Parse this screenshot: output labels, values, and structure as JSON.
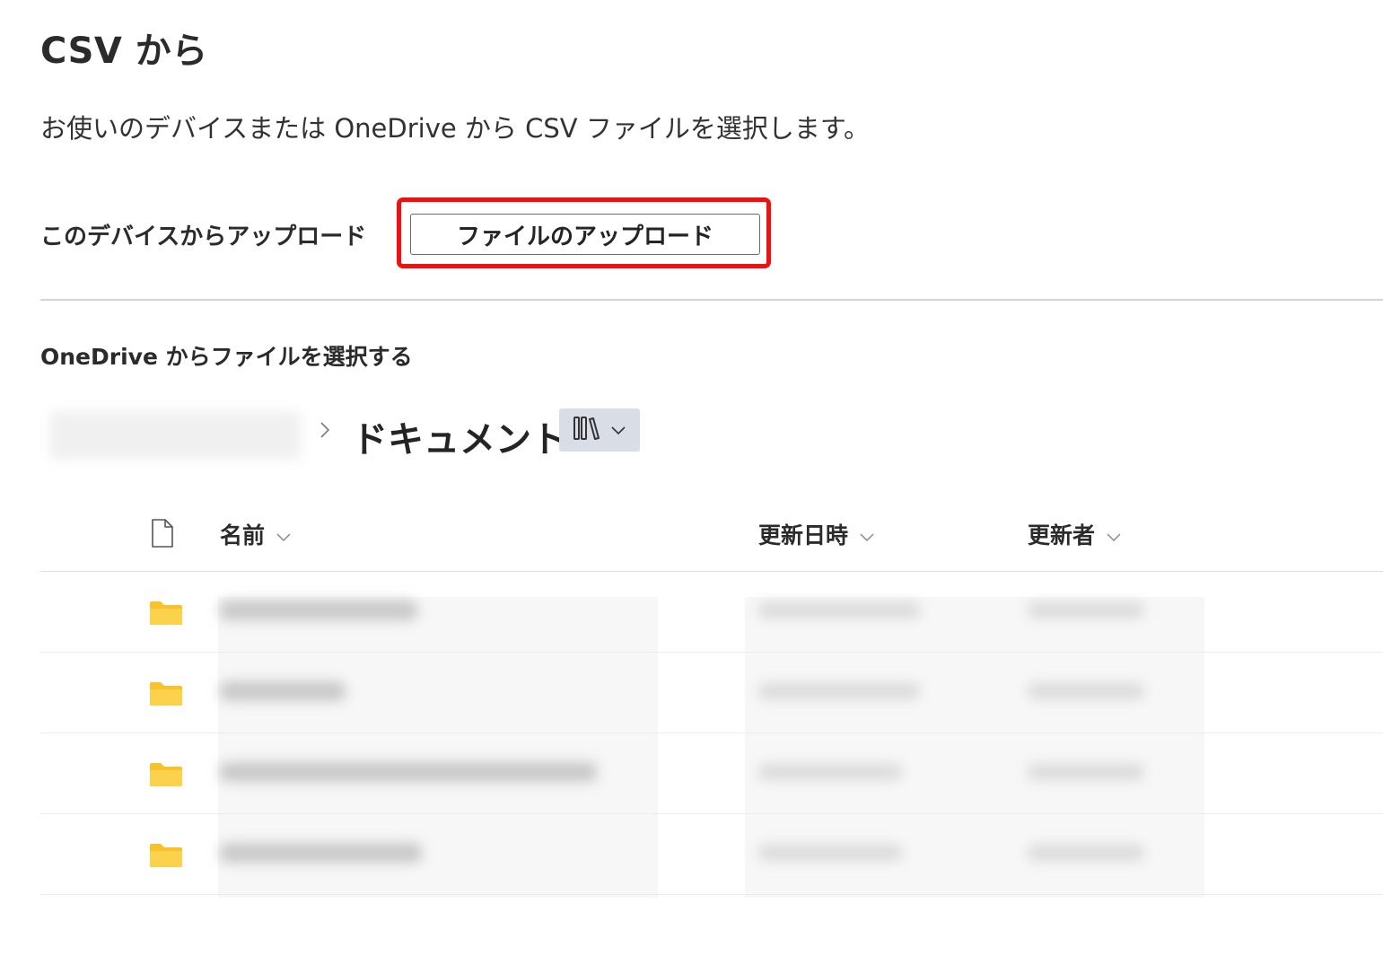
{
  "header": {
    "title": "CSV から",
    "subtitle": "お使いのデバイスまたは OneDrive から CSV ファイルを選択します。"
  },
  "upload": {
    "label": "このデバイスからアップロード",
    "button_label": "ファイルのアップロード"
  },
  "onedrive": {
    "section_title": "OneDrive からファイルを選択する",
    "breadcrumb_current": "ドキュメント"
  },
  "table": {
    "columns": [
      "名前",
      "更新日時",
      "更新者"
    ],
    "row_count_visible": 4
  },
  "colors": {
    "highlight": "#ee1111",
    "folder": "#f8c22a",
    "library_button_bg": "#d8dde6"
  },
  "icons": {
    "file": "file-icon",
    "folder": "folder-icon",
    "library": "library-icon",
    "chevron": "chevron-down-icon"
  }
}
